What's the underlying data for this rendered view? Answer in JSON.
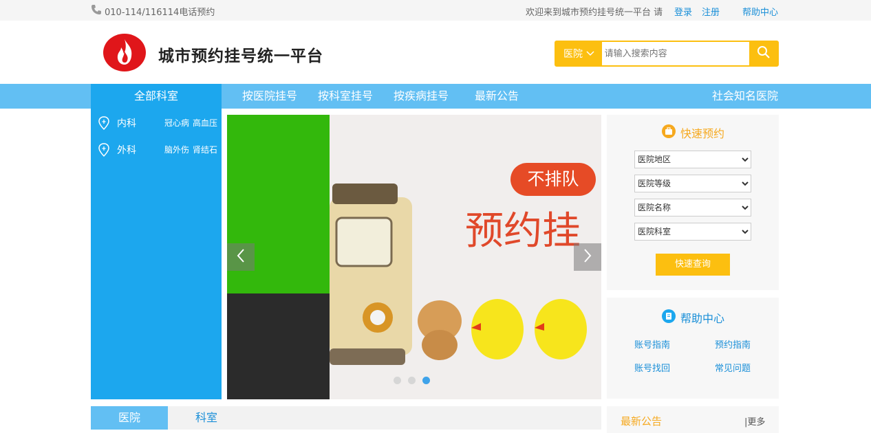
{
  "topbar": {
    "phone": "010-114/116114电话预约",
    "welcome": "欢迎来到城市预约挂号统一平台 请",
    "login": "登录",
    "register": "注册",
    "help": "帮助中心"
  },
  "header": {
    "title": "城市预约挂号统一平台",
    "search_category": "医院",
    "search_placeholder": "请输入搜索内容"
  },
  "nav": {
    "all": "全部科室",
    "items": [
      "按医院挂号",
      "按科室挂号",
      "按疾病挂号",
      "最新公告"
    ],
    "right": "社会知名医院"
  },
  "departments": [
    {
      "name": "内科",
      "tags": [
        "冠心病",
        "高血压"
      ]
    },
    {
      "name": "外科",
      "tags": [
        "脑外伤",
        "肾结石"
      ]
    }
  ],
  "banner": {
    "bubble": "不排队",
    "headline": "预约挂",
    "slide_active": 3,
    "slide_count": 3
  },
  "quick": {
    "title": "快速预约",
    "selects": [
      "医院地区",
      "医院等级",
      "医院名称",
      "医院科室"
    ],
    "button": "快速查询"
  },
  "help": {
    "title": "帮助中心",
    "links": [
      "账号指南",
      "预约指南",
      "账号找回",
      "常见问题"
    ]
  },
  "tabs": [
    "医院",
    "科室"
  ],
  "news": {
    "title": "最新公告",
    "more": "|更多"
  },
  "colors": {
    "blue": "#1ca7ee",
    "light_blue": "#62bff3",
    "yellow": "#fcbf10",
    "orange_text": "#f6a91f"
  }
}
